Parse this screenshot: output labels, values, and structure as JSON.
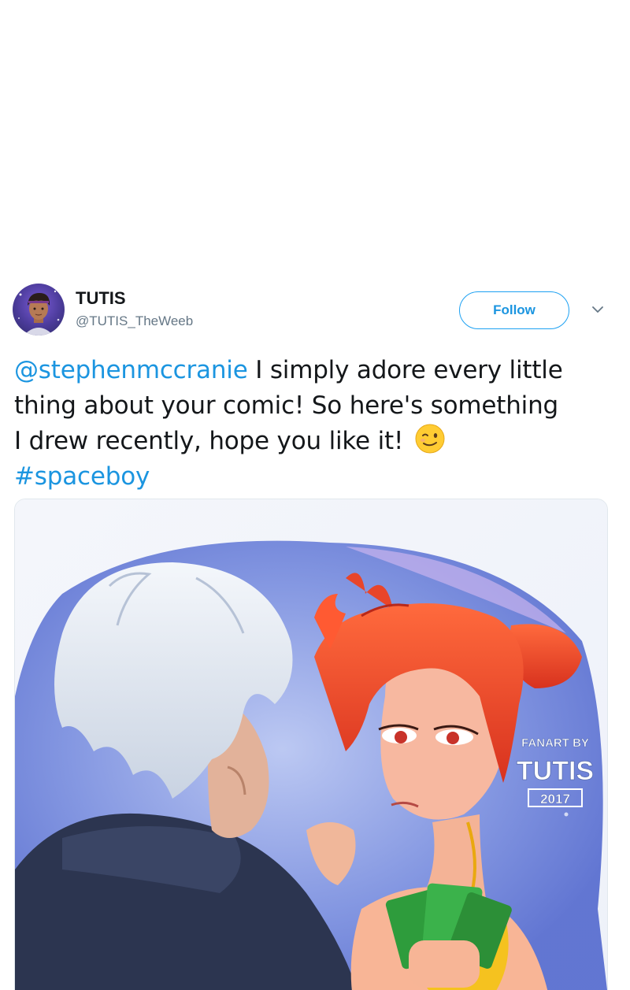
{
  "tweet": {
    "author": {
      "display_name": "TUTIS",
      "handle": "@TUTIS_TheWeeb"
    },
    "follow_label": "Follow",
    "text": {
      "mention": "@stephenmccranie",
      "body_line1": " I simply adore every little",
      "body_line2": "thing about your comic! So here's something",
      "body_line3": "I drew recently, hope you like it! ",
      "hashtag": "#spaceboy"
    },
    "media": {
      "watermark_line1": "FANART BY",
      "watermark_line2": "TUTIS",
      "watermark_line3": "2017"
    }
  },
  "icons": {
    "caret": "chevron-down-icon",
    "emoji": "winking-face-emoji-icon",
    "avatar": "avatar"
  },
  "colors": {
    "link": "#1b95e0",
    "follow_border": "#1da1f2",
    "text": "#14171a",
    "muted": "#657786"
  }
}
